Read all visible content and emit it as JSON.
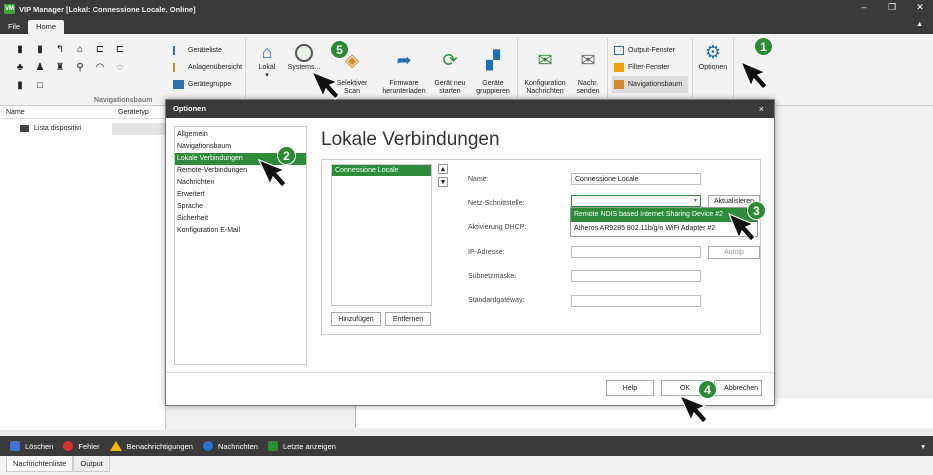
{
  "window": {
    "title": "VIP Manager [Lokal: Connessione Locale, Online]",
    "app_icon_text": "VM",
    "controls": [
      "–",
      "❐",
      "✕"
    ]
  },
  "menu": {
    "tabs": [
      "File",
      "Home"
    ],
    "caret": "▲"
  },
  "ribbon": {
    "nav_group": {
      "items": [
        "Geräteliste",
        "Anlagenübersicht",
        "Gerätegruppe"
      ],
      "label": "Navigationsbaum"
    },
    "buttons": {
      "lokal": "Lokal",
      "lokal_caret": "▾",
      "systemscan": "Systems...",
      "selektiver_scan": "Selektiver\nScan",
      "firmware": "Firmware\nherunterladen",
      "neustart": "Gerät neu\nstarten",
      "gruppieren": "Geräte\ngruppieren",
      "konfiguration": "Konfiguration\nNachrichten",
      "nachr_senden": "Nachr.\nsenden",
      "optionen": "Optionen"
    },
    "window_group": {
      "items": [
        "Output-Fenster",
        "Filter-Fenster",
        "Navigationsbaum"
      ]
    }
  },
  "left_panel": {
    "columns": [
      "Name",
      "Gerätetyp"
    ],
    "rows": [
      "Lista dispositivi"
    ]
  },
  "dialog": {
    "title": "Optionen",
    "close": "×",
    "nav": [
      "Allgemein",
      "Navigationsbaum",
      "Lokale Verbindungen",
      "Remote-Verbindungen",
      "Nachrichten",
      "Erweitert",
      "Sprache",
      "Sicherheit",
      "Konfiguration E-Mail"
    ],
    "selected_nav": "Lokale Verbindungen",
    "heading": "Lokale Verbindungen",
    "connections": [
      "Connessione Locale"
    ],
    "up": "▲",
    "down": "▼",
    "add_button": "Hinzufügen",
    "remove_button": "Entfernen",
    "fields": {
      "name_label": "Name:",
      "name_value": "Connessione Locale",
      "interface_label": "Netz-Schnittstelle:",
      "interface_value": "",
      "interface_caret": "▾",
      "refresh_button": "Aktualisieren",
      "dhcp_label": "Aktivierung DHCP:",
      "ip_label": "IP-Adresse:",
      "autoip_button": "Autoip",
      "subnet_label": "Subnetzmaske:",
      "gateway_label": "Standardgateway:"
    },
    "dropdown_options": [
      "Remote NDIS based Internet Sharing Device #2",
      "Atheros AR9285 802.11b/g/n WiFi Adapter #2"
    ],
    "help_button": "Help",
    "ok_button": "OK",
    "cancel_button": "Abbrechen"
  },
  "bottom": {
    "toolbar": [
      "Löschen",
      "Fehler",
      "Benachrichtigungen",
      "Nachrichten",
      "Letzte anzeigen"
    ],
    "caret": "▾",
    "tabs": [
      "Nachrichtenliste",
      "Output"
    ]
  },
  "steps": [
    "1",
    "2",
    "3",
    "4",
    "5"
  ],
  "colors": {
    "accent_green": "#2e8b3a",
    "badge_green": "#2b8a34",
    "dark_bar": "#3a3a3a",
    "ribbon_bg": "#f3f3f3"
  }
}
